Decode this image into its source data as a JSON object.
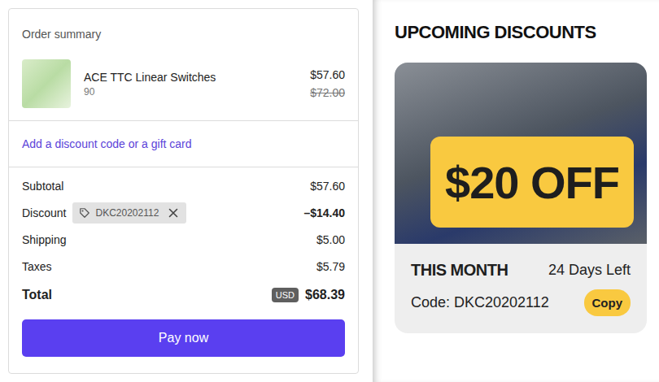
{
  "order_summary": {
    "title": "Order summary",
    "item": {
      "name": "ACE TTC Linear Switches",
      "quantity": "90",
      "price": "$57.60",
      "original_price": "$72.00"
    },
    "discount_link": "Add a discount code or a gift card",
    "lines": [
      {
        "kind": "plain",
        "label": "Subtotal",
        "value": "$57.60"
      },
      {
        "kind": "discount",
        "label": "Discount",
        "code": "DKC20202112",
        "value": "–$14.40"
      },
      {
        "kind": "plain",
        "label": "Shipping",
        "value": "$5.00"
      },
      {
        "kind": "plain",
        "label": "Taxes",
        "value": "$5.79"
      }
    ],
    "total": {
      "label": "Total",
      "currency": "USD",
      "value": "$68.39"
    },
    "pay_button": "Pay now"
  },
  "upcoming": {
    "title": "UPCOMING DISCOUNTS",
    "card": {
      "badge": "$20 OFF",
      "period": "THIS MONTH",
      "days_left": "24 Days Left",
      "code_label": "Code: DKC20202112",
      "copy_button": "Copy"
    }
  }
}
